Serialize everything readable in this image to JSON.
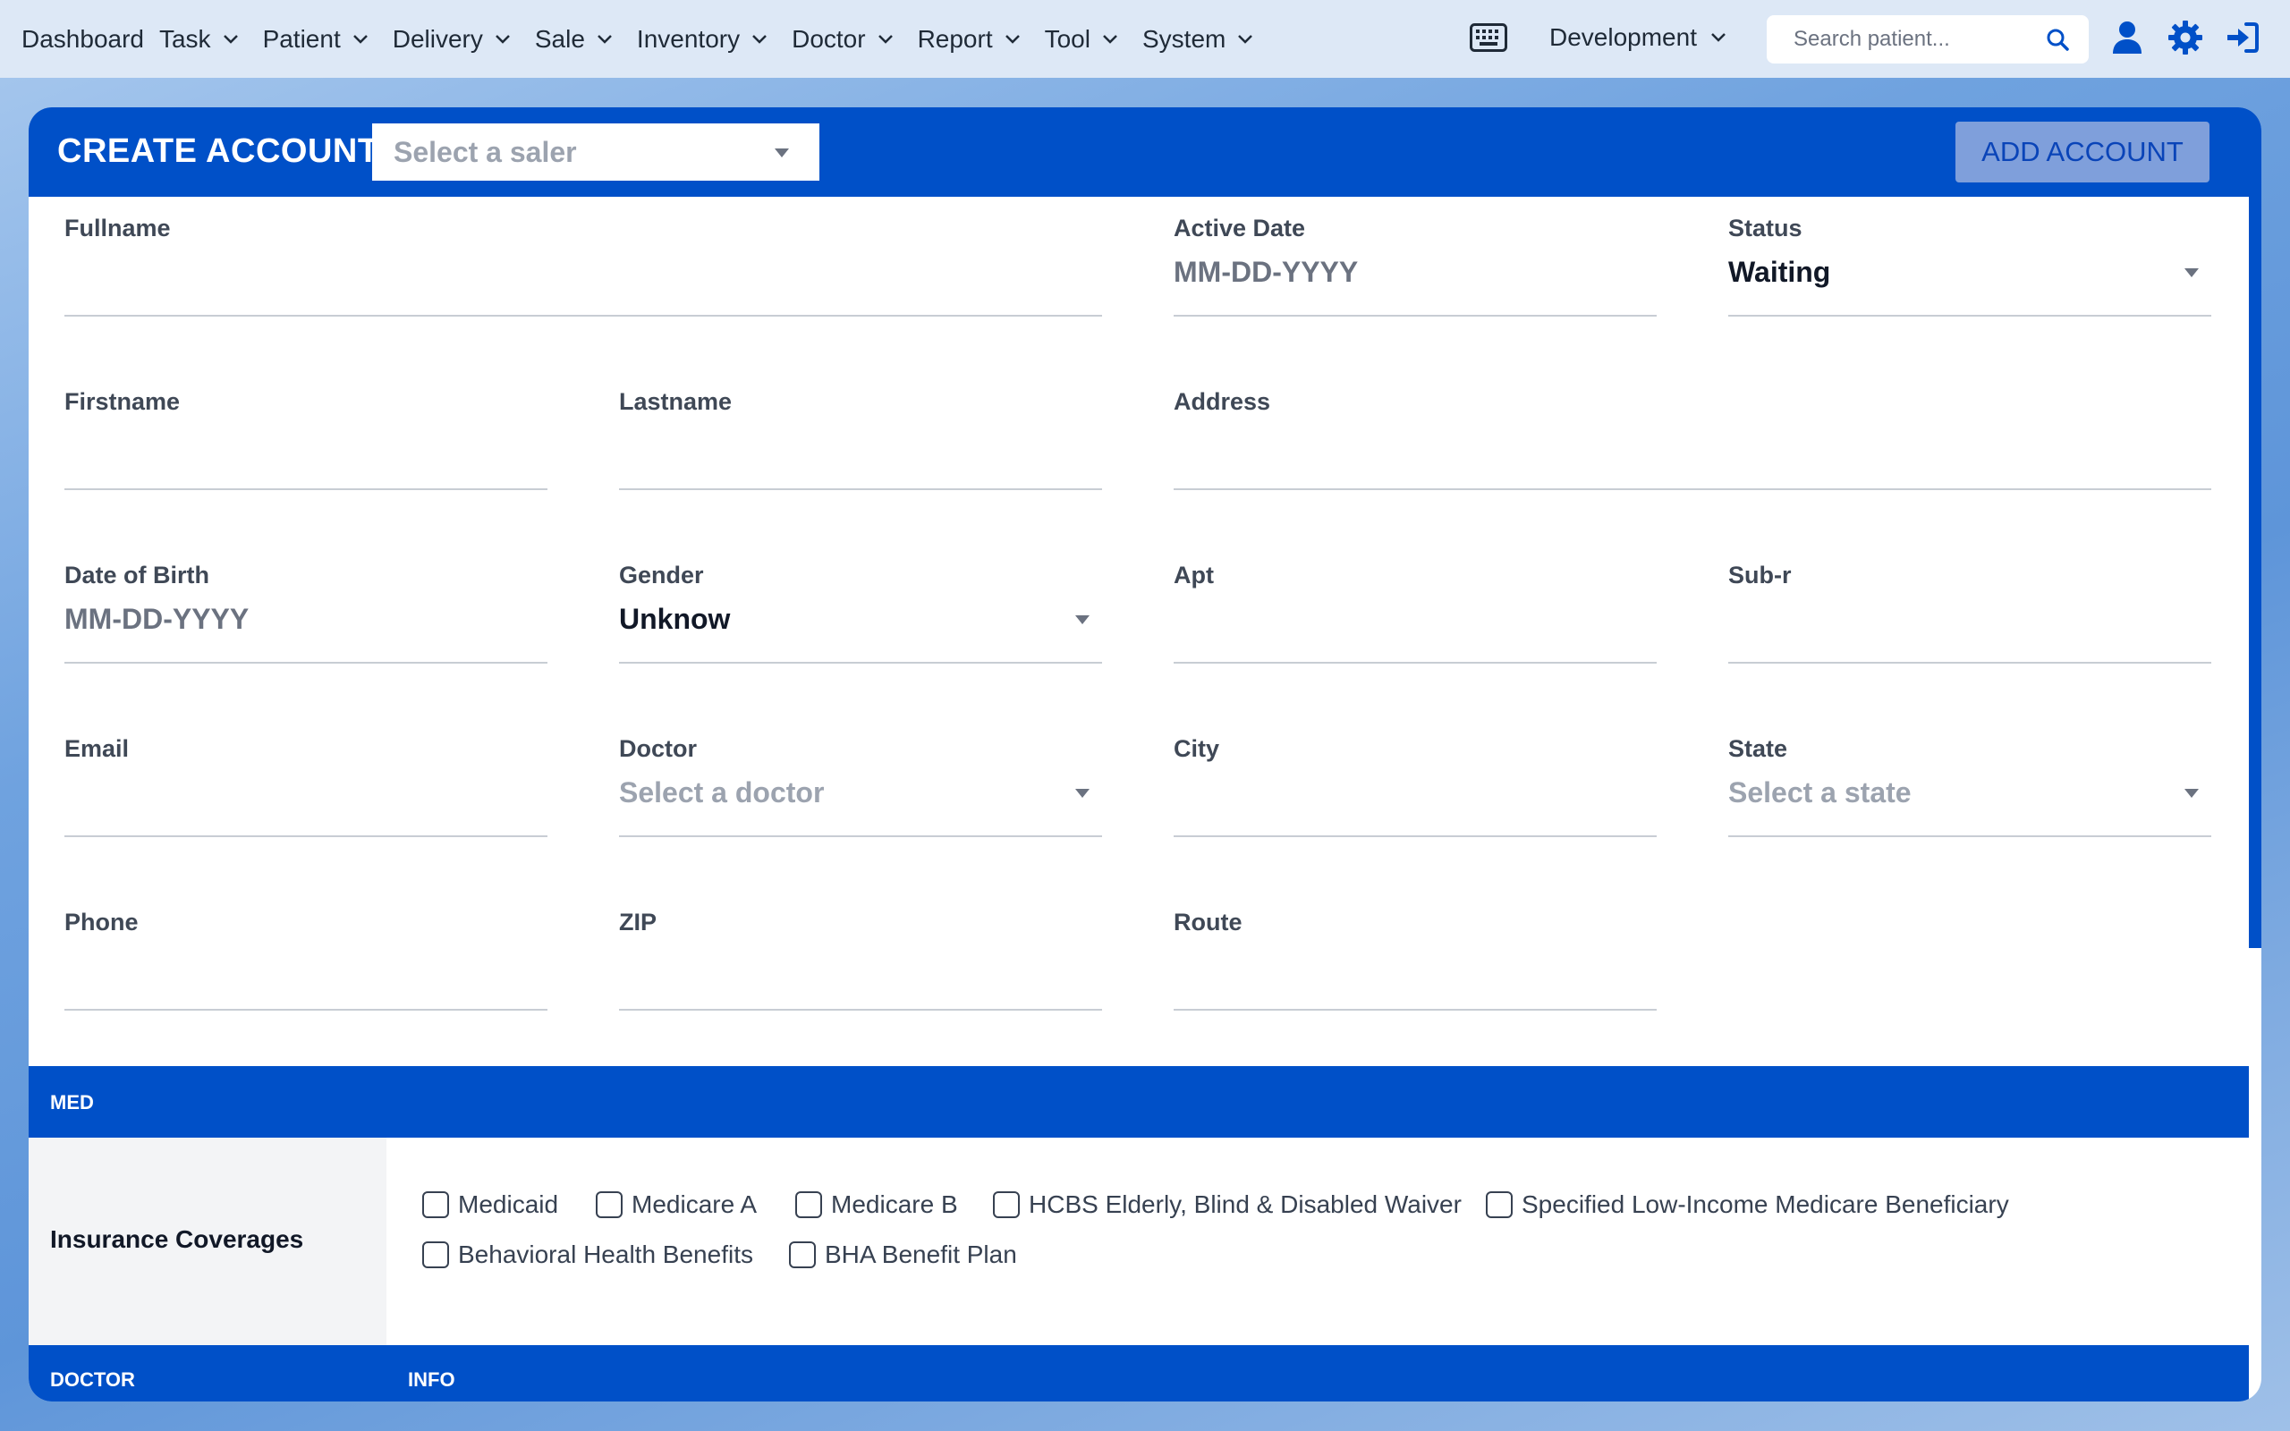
{
  "nav": {
    "items": [
      {
        "label": "Dashboard",
        "has_menu": false
      },
      {
        "label": "Task",
        "has_menu": true
      },
      {
        "label": "Patient",
        "has_menu": true
      },
      {
        "label": "Delivery",
        "has_menu": true
      },
      {
        "label": "Sale",
        "has_menu": true
      },
      {
        "label": "Inventory",
        "has_menu": true
      },
      {
        "label": "Doctor",
        "has_menu": true
      },
      {
        "label": "Report",
        "has_menu": true
      },
      {
        "label": "Tool",
        "has_menu": true
      },
      {
        "label": "System",
        "has_menu": true
      }
    ],
    "environment": "Development",
    "search_placeholder": "Search patient..."
  },
  "header": {
    "title": "CREATE ACCOUNT",
    "saler_placeholder": "Select a saler",
    "add_button": "ADD ACCOUNT"
  },
  "form": {
    "fullname": {
      "label": "Fullname"
    },
    "active_date": {
      "label": "Active Date",
      "placeholder": "MM-DD-YYYY"
    },
    "status": {
      "label": "Status",
      "value": "Waiting"
    },
    "firstname": {
      "label": "Firstname"
    },
    "lastname": {
      "label": "Lastname"
    },
    "address": {
      "label": "Address"
    },
    "dob": {
      "label": "Date of Birth",
      "placeholder": "MM-DD-YYYY"
    },
    "gender": {
      "label": "Gender",
      "value": "Unknow"
    },
    "apt": {
      "label": "Apt"
    },
    "subr": {
      "label": "Sub-r"
    },
    "email": {
      "label": "Email"
    },
    "doctor": {
      "label": "Doctor",
      "placeholder": "Select a doctor"
    },
    "city": {
      "label": "City"
    },
    "state": {
      "label": "State",
      "placeholder": "Select a state"
    },
    "phone": {
      "label": "Phone"
    },
    "zip": {
      "label": "ZIP"
    },
    "route": {
      "label": "Route"
    }
  },
  "med": {
    "section_title": "MED",
    "coverage_label": "Insurance Coverages",
    "options": [
      "Medicaid",
      "Medicare A",
      "Medicare B",
      "HCBS Elderly, Blind & Disabled Waiver",
      "Specified Low-Income Medicare Beneficiary",
      "Behavioral Health Benefits",
      "BHA Benefit Plan"
    ]
  },
  "doctor_section": {
    "col1": "DOCTOR",
    "col2": "INFO"
  },
  "colors": {
    "brand_blue": "#0050c8",
    "nav_bg": "#dde8f6",
    "add_button_bg": "#7f9fdb"
  }
}
